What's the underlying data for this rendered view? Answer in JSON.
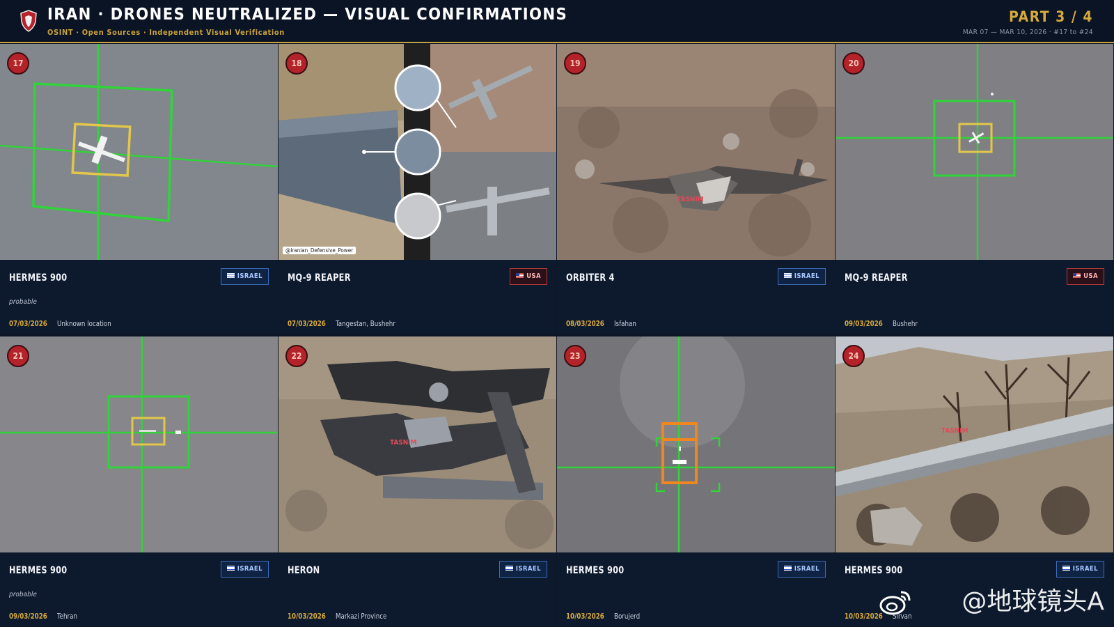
{
  "header": {
    "title": "IRAN · DRONES NEUTRALIZED — VISUAL CONFIRMATIONS",
    "subtitle": "OSINT · Open Sources · Independent Visual Verification",
    "part": "PART 3 / 4",
    "range": "MAR 07 — MAR 10, 2026  ·  #17 to #24"
  },
  "cards": [
    {
      "number": "17",
      "name": "HERMES 900",
      "country": "ISRAEL",
      "note": "probable",
      "date": "07/03/2026",
      "location": "Unknown location",
      "photo": "thermal-tracking-frame"
    },
    {
      "number": "18",
      "name": "MQ-9 REAPER",
      "country": "USA",
      "note": "",
      "date": "07/03/2026",
      "location": "Tangestan, Bushehr",
      "photo": "wing-debris-comparison",
      "credit": "@Iranian_Defensive_Power"
    },
    {
      "number": "19",
      "name": "ORBITER 4",
      "country": "ISRAEL",
      "note": "",
      "date": "08/03/2026",
      "location": "Isfahan",
      "photo": "wreckage-on-ground"
    },
    {
      "number": "20",
      "name": "MQ-9 REAPER",
      "country": "USA",
      "note": "",
      "date": "09/03/2026",
      "location": "Bushehr",
      "photo": "thermal-tracking-frame"
    },
    {
      "number": "21",
      "name": "HERMES 900",
      "country": "ISRAEL",
      "note": "probable",
      "date": "09/03/2026",
      "location": "Tehran",
      "photo": "thermal-tracking-frame"
    },
    {
      "number": "22",
      "name": "HERON",
      "country": "ISRAEL",
      "note": "",
      "date": "10/03/2026",
      "location": "Markazi Province",
      "photo": "burnt-wreckage",
      "credit": "TASNIM"
    },
    {
      "number": "23",
      "name": "HERMES 900",
      "country": "ISRAEL",
      "note": "",
      "date": "10/03/2026",
      "location": "Borujerd",
      "photo": "thermal-tracking-frame"
    },
    {
      "number": "24",
      "name": "HERMES 900",
      "country": "ISRAEL",
      "note": "",
      "date": "10/03/2026",
      "location": "Sirvan",
      "photo": "wing-on-hillside",
      "credit": "TASNIM"
    }
  ],
  "watermark": "@地球镜头A",
  "colors": {
    "accent": "#d6a93a",
    "badge": "#b4222a",
    "israel": "#3d6db8",
    "usa": "#b83a3a",
    "tracking": "#2ad33a"
  }
}
